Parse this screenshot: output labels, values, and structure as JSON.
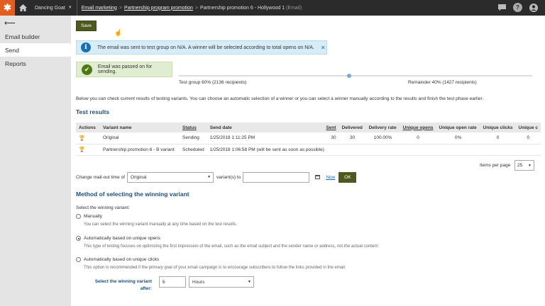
{
  "topbar": {
    "logo": "✱",
    "home_icon": "home-icon",
    "site_name": "Dancing Goat",
    "breadcrumb": {
      "item1": "Email marketing",
      "item2": "Partnership program promotion",
      "item3": "Partnership promotion 6 - Hollywood 1",
      "item3_suffix": "(Email)"
    },
    "icons": [
      "chat-icon",
      "help-icon",
      "user-icon"
    ]
  },
  "sidebar": {
    "back_glyph": "⟵",
    "items": [
      {
        "label": "Email builder",
        "active": false
      },
      {
        "label": "Send",
        "active": true
      },
      {
        "label": "Reports",
        "active": false
      }
    ]
  },
  "main": {
    "save_label": "Save",
    "info_message": "The email was sent to test group on N/A. A winner will be selected according to total opens on N/A.",
    "success_message": "Email was passed on for sending.",
    "split": {
      "test_group": "Test group 60% (2136 recipients)",
      "remainder": "Remainder 40% (1427 recipients)",
      "test_fraction": 0.6
    },
    "description": "Below you can check current results of testing variants. You can choose an automatic selection of a winner or you can select a winner manually according to the results and finish the test phase earlier.",
    "test_results_heading": "Test results",
    "table": {
      "headers": [
        "Actions",
        "Variant name",
        "Status",
        "Send date",
        "Sent",
        "Delivered",
        "Delivery rate",
        "Unique opens",
        "Unique open rate",
        "Unique clicks",
        "Unique c"
      ],
      "rows": [
        {
          "variant": "Original",
          "status": "Sending",
          "send_date": "1/25/2018 1:11:25 PM",
          "sent": "30",
          "delivered": "30",
          "delivery_rate": "100.00%",
          "unique_opens": "0",
          "unique_open_rate": "0%",
          "unique_clicks": "0",
          "unique_c": "0"
        },
        {
          "variant": "Partnership promotion 6 - B variant",
          "status": "Scheduled",
          "send_date": "1/25/2018 1:06:58 PM (will be sent as soon as possible)",
          "sent": "",
          "delivered": "",
          "delivery_rate": "",
          "unique_opens": "",
          "unique_open_rate": "",
          "unique_clicks": "",
          "unique_c": ""
        }
      ]
    },
    "items_per_page_label": "Items per page",
    "items_per_page_value": "25",
    "mailout": {
      "label": "Change mail-out time of",
      "variant_value": "Original",
      "to_label": "variant(s) to",
      "date_value": "",
      "now_label": "Now",
      "ok_label": "OK"
    },
    "method_heading": "Method of selecting the winning variant",
    "select_winning_label": "Select the winning variant:",
    "options": [
      {
        "label": "Manually",
        "help": "You can select the winning variant manually at any time based on the test results.",
        "selected": false
      },
      {
        "label": "Automatically based on unique opens",
        "help": "This type of testing focuses on optimizing the first impression of the email, such as the email subject and the sender name or address, not the actual content.",
        "selected": true
      },
      {
        "label": "Automatically based on unique clicks",
        "help": "This option is recommended if the primary goal of your email campaign is to encourage subscribers to follow the links provided in the email.",
        "selected": false
      }
    ],
    "after": {
      "label_line1": "Select the winning variant",
      "label_line2": "after:",
      "value": "6",
      "unit": "Hours"
    }
  }
}
